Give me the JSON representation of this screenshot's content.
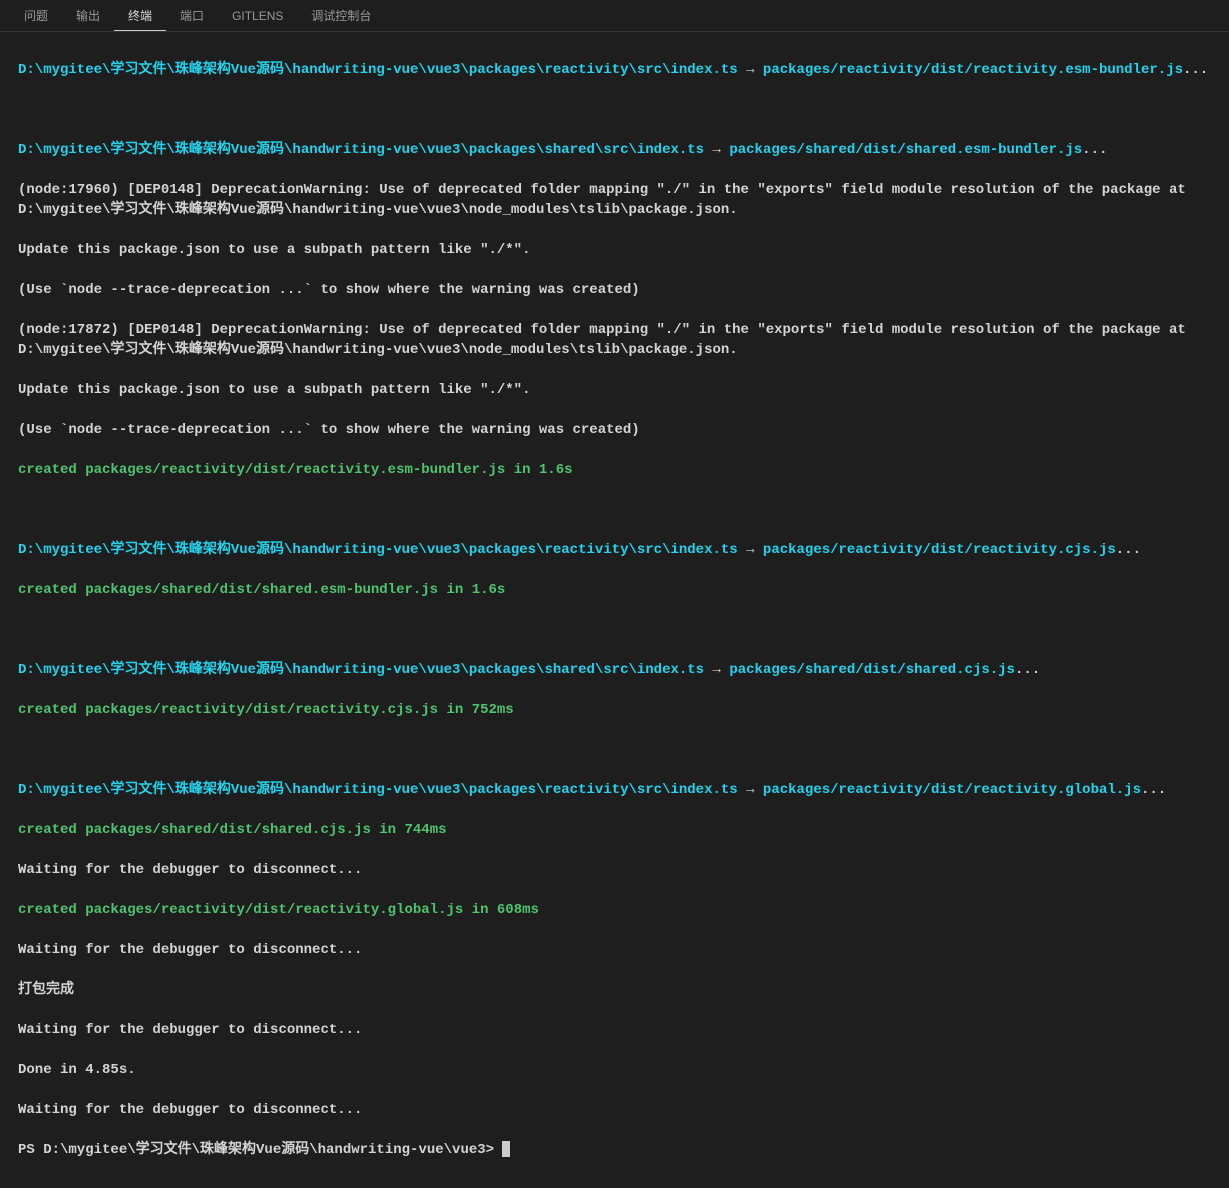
{
  "tabs": {
    "problems": "问题",
    "output": "输出",
    "terminal": "终端",
    "ports": "端口",
    "gitlens": "GITLENS",
    "debug": "调试控制台"
  },
  "paths": {
    "reactivity_src": "D:\\mygitee\\学习文件\\珠峰架构Vue源码\\handwriting-vue\\vue3\\packages\\reactivity\\src\\index.ts",
    "shared_src": "D:\\mygitee\\学习文件\\珠峰架构Vue源码\\handwriting-vue\\vue3\\packages\\shared\\src\\index.ts",
    "prompt": "PS D:\\mygitee\\学习文件\\珠峰架构Vue源码\\handwriting-vue\\vue3> "
  },
  "targets": {
    "reactivity_esm": "packages/reactivity/dist/reactivity.esm-bundler.js",
    "shared_esm": "packages/shared/dist/shared.esm-bundler.js",
    "reactivity_cjs": "packages/reactivity/dist/reactivity.cjs.js",
    "shared_cjs": "packages/shared/dist/shared.cjs.js",
    "reactivity_global": "packages/reactivity/dist/reactivity.global.js"
  },
  "arrow": " → ",
  "ellipsis": "...",
  "warn": {
    "l1a": "(node:17960) [DEP0148] DeprecationWarning: Use of deprecated folder mapping \"./\" in the \"exports\" field module resolution of the package at D:\\mygitee\\学习文件\\珠峰架构Vue源码\\handwriting-vue\\vue3\\node_modules\\tslib\\package.json.",
    "l2": "Update this package.json to use a subpath pattern like \"./*\".",
    "l3": "(Use `node --trace-deprecation ...` to show where the warning was created)",
    "l1b": "(node:17872) [DEP0148] DeprecationWarning: Use of deprecated folder mapping \"./\" in the \"exports\" field module resolution of the package at D:\\mygitee\\学习文件\\珠峰架构Vue源码\\handwriting-vue\\vue3\\node_modules\\tslib\\package.json."
  },
  "created": "created ",
  "in": " in ",
  "times": {
    "t1": "1.6s",
    "t2": "1.6s",
    "t3": "752ms",
    "t4": "744ms",
    "t5": "608ms"
  },
  "msgs": {
    "wait": "Waiting for the debugger to disconnect...",
    "done_pack": "打包完成",
    "done": "Done in 4.85s."
  }
}
